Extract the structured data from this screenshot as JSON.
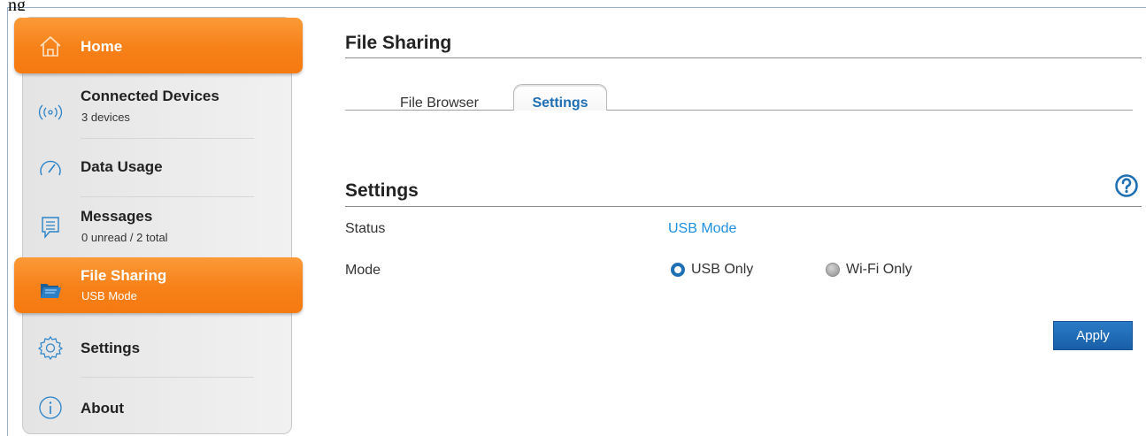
{
  "top_text": "ng",
  "sidebar": {
    "items": [
      {
        "label": "Home",
        "sub": "",
        "icon": "home-icon",
        "active": true
      },
      {
        "label": "Connected Devices",
        "sub": "3 devices",
        "icon": "wireless-signal-icon",
        "active": false
      },
      {
        "label": "Data Usage",
        "sub": "",
        "icon": "gauge-icon",
        "active": false
      },
      {
        "label": "Messages",
        "sub": "0 unread / 2 total",
        "icon": "message-icon",
        "active": false
      },
      {
        "label": "File Sharing",
        "sub": "USB Mode",
        "icon": "folder-icon",
        "active": true
      },
      {
        "label": "Settings",
        "sub": "",
        "icon": "gear-icon",
        "active": false
      },
      {
        "label": "About",
        "sub": "",
        "icon": "info-icon",
        "active": false
      }
    ]
  },
  "main": {
    "title": "File Sharing",
    "tabs": [
      {
        "label": "File Browser",
        "selected": false
      },
      {
        "label": "Settings",
        "selected": true
      }
    ],
    "section_title": "Settings",
    "help_icon": "help-icon",
    "status": {
      "label": "Status",
      "value": "USB Mode"
    },
    "mode": {
      "label": "Mode",
      "options": [
        {
          "label": "USB Only",
          "selected": true
        },
        {
          "label": "Wi-Fi Only",
          "selected": false
        }
      ]
    },
    "apply_label": "Apply"
  },
  "colors": {
    "accent_orange": "#f78018",
    "link_blue": "#1f8fe0",
    "button_blue": "#1f6fb5"
  }
}
